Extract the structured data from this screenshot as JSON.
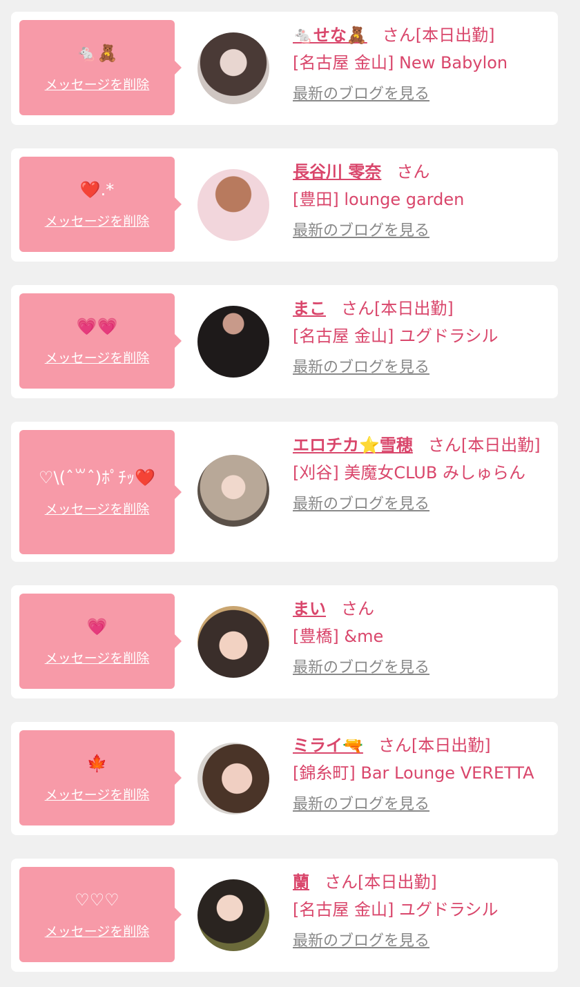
{
  "delete_label": "メッセージを削除",
  "blog_label": "最新のブログを見る",
  "colors": {
    "accent_pink": "#d9466b",
    "bubble_pink": "#f79aa8",
    "background": "#f0f0f0",
    "card": "#ffffff",
    "link_gray": "#888888"
  },
  "items": [
    {
      "message": "🐁🧸",
      "name": "🐁せな🧸",
      "suffix": "さん[本日出勤]",
      "shop": "[名古屋 金山] New Babylon"
    },
    {
      "message": "❤️.*",
      "name": "長谷川 零奈",
      "suffix": "さん",
      "shop": "[豊田] lounge garden"
    },
    {
      "message": "💗💗",
      "name": "まこ",
      "suffix": "さん[本日出勤]",
      "shop": "[名古屋 金山] ユグドラシル"
    },
    {
      "message": "♡\\(ˆ꒳ˆ)ﾎﾟﾁｯ❤️",
      "name": "エロチカ⭐雪穂",
      "suffix": "さん[本日出勤]",
      "shop": "[刈谷] 美魔女CLUB みしゅらん"
    },
    {
      "message": "💗",
      "name": "まい",
      "suffix": "さん",
      "shop": "[豊橋] &me"
    },
    {
      "message": "🍁",
      "name": "ミライ🔫",
      "suffix": "さん[本日出勤]",
      "shop": "[錦糸町] Bar Lounge VERETTA"
    },
    {
      "message": "♡♡♡",
      "name": "蘭",
      "suffix": "さん[本日出勤]",
      "shop": "[名古屋 金山] ユグドラシル"
    }
  ]
}
